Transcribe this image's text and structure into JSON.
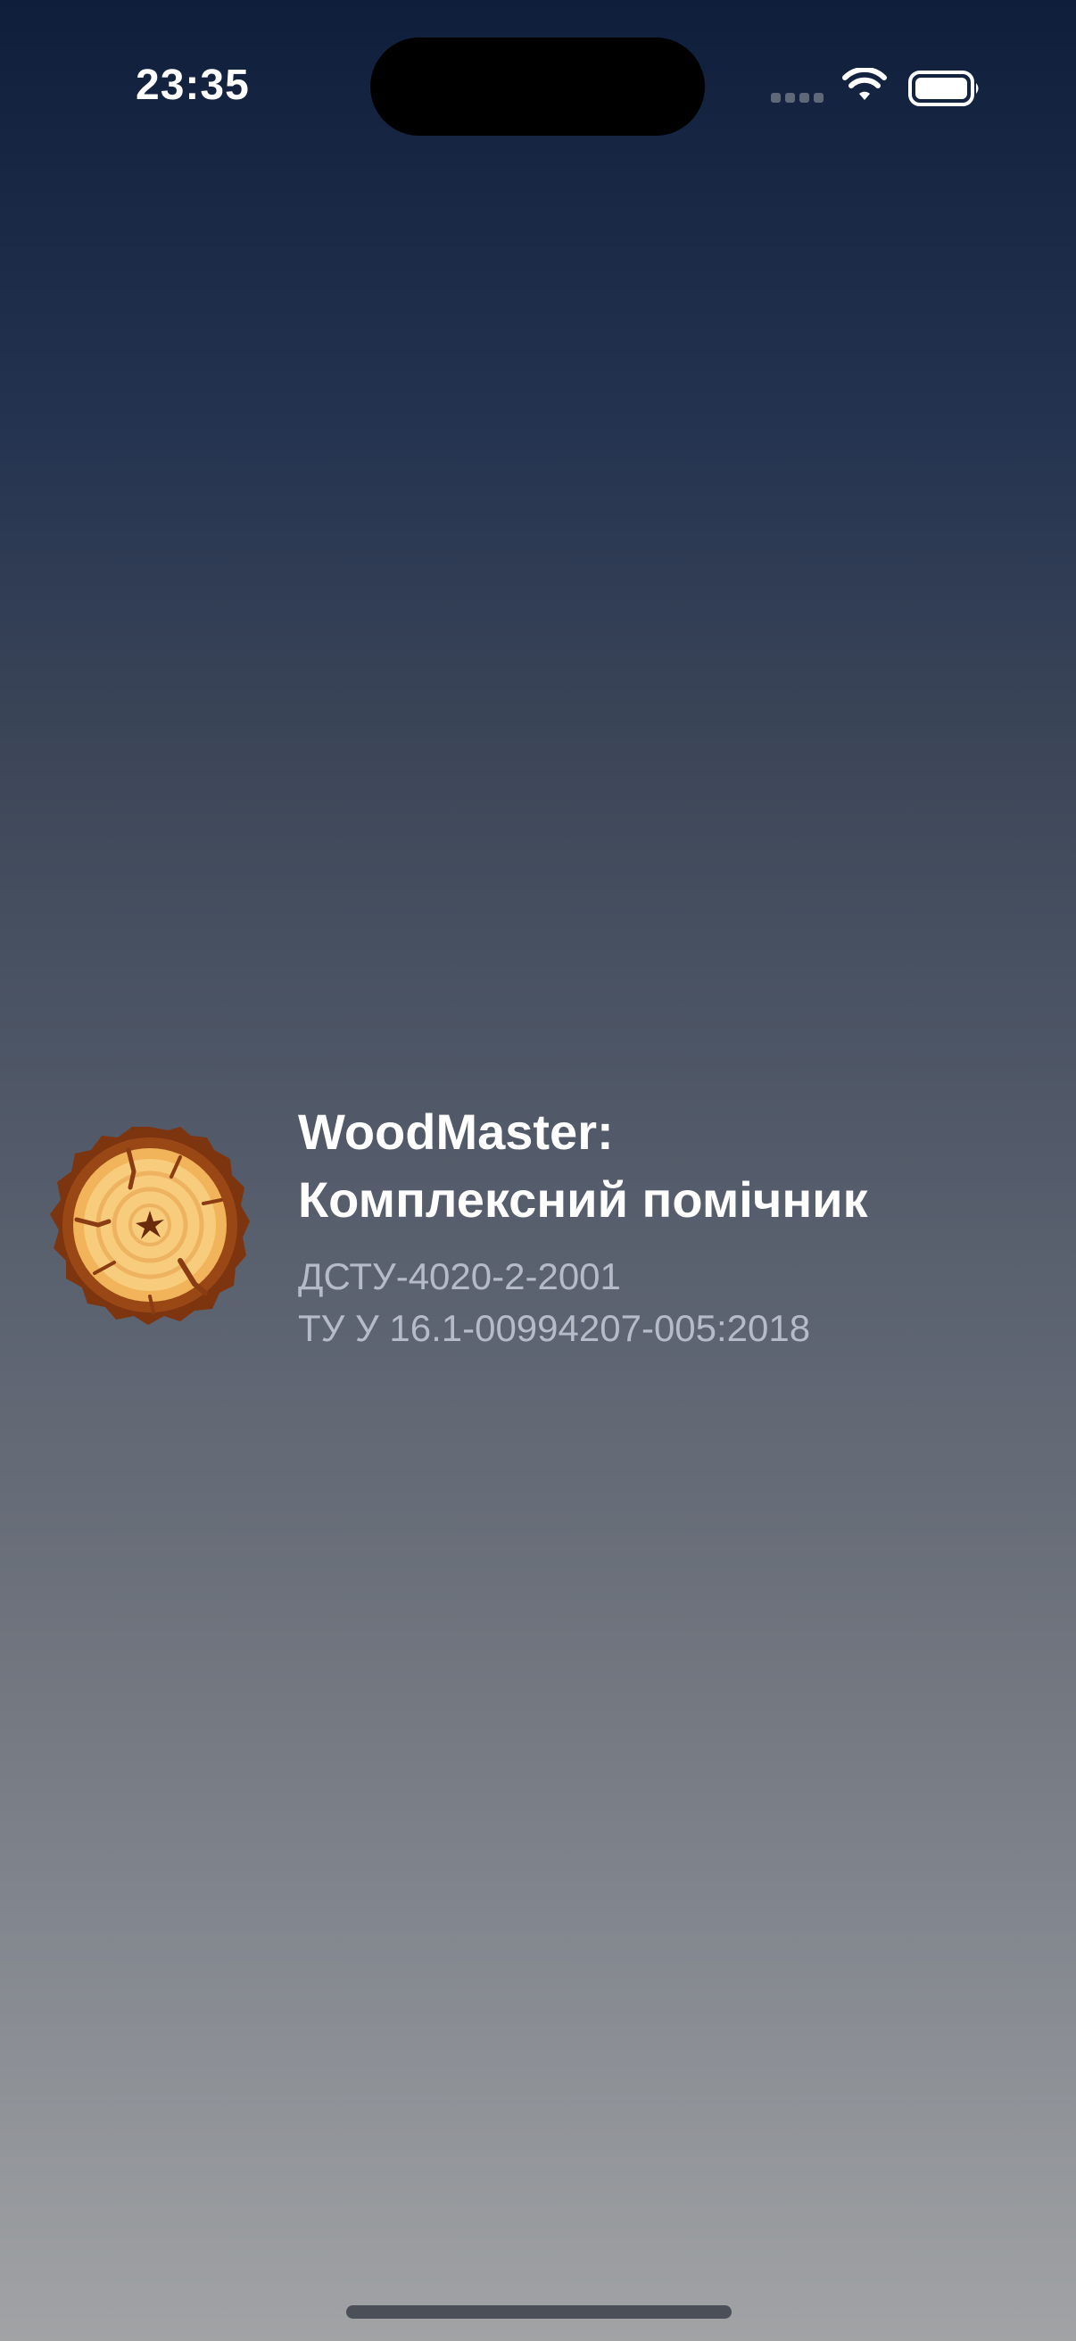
{
  "status_bar": {
    "time": "23:35"
  },
  "splash": {
    "title_line1": "WoodMaster:",
    "title_line2": "Комплексний помічник",
    "standards": [
      "ДСТУ-4020-2-2001",
      "ТУ У 16.1-00994207-005:2018"
    ],
    "logo_icon": "wood-log-cross-section-icon"
  },
  "colors": {
    "background_top": "#0f1f3b",
    "background_bottom": "#a1a3a5",
    "subtitle_text": "#b6bcc7",
    "logo_bark": "#8a3c12",
    "logo_wood": "#f6c777"
  }
}
